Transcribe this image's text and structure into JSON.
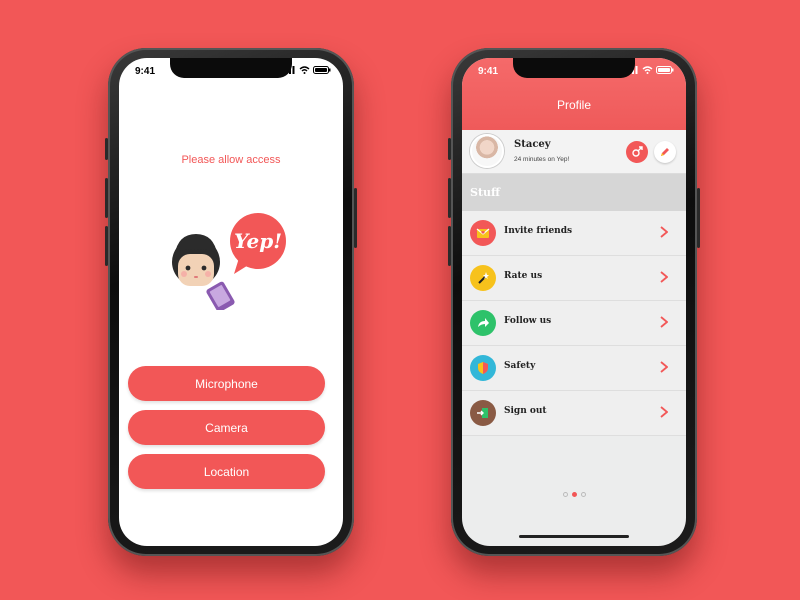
{
  "left_phone": {
    "status_time": "9:41",
    "title": "Please allow access",
    "logo_text": "Yep!",
    "buttons": [
      {
        "label": "Microphone"
      },
      {
        "label": "Camera"
      },
      {
        "label": "Location"
      }
    ]
  },
  "right_phone": {
    "status_time": "9:41",
    "header_title": "Profile",
    "profile": {
      "name": "Stacey",
      "status": "24 minutes on Yep!"
    },
    "section_title": "Stuff",
    "menu": [
      {
        "label": "Invite friends",
        "icon": "envelope-icon",
        "color": "#f25757"
      },
      {
        "label": "Rate us",
        "icon": "magic-wand-icon",
        "color": "#f7c21c"
      },
      {
        "label": "Follow us",
        "icon": "share-arrow-icon",
        "color": "#2ec26a"
      },
      {
        "label": "Safety",
        "icon": "shield-icon",
        "color": "#32b7d8"
      },
      {
        "label": "Sign out",
        "icon": "exit-door-icon",
        "color": "#8a5a44"
      }
    ],
    "page_dots": {
      "count": 3,
      "active": 1
    }
  },
  "colors": {
    "accent": "#f25757",
    "background": "#f25757"
  }
}
